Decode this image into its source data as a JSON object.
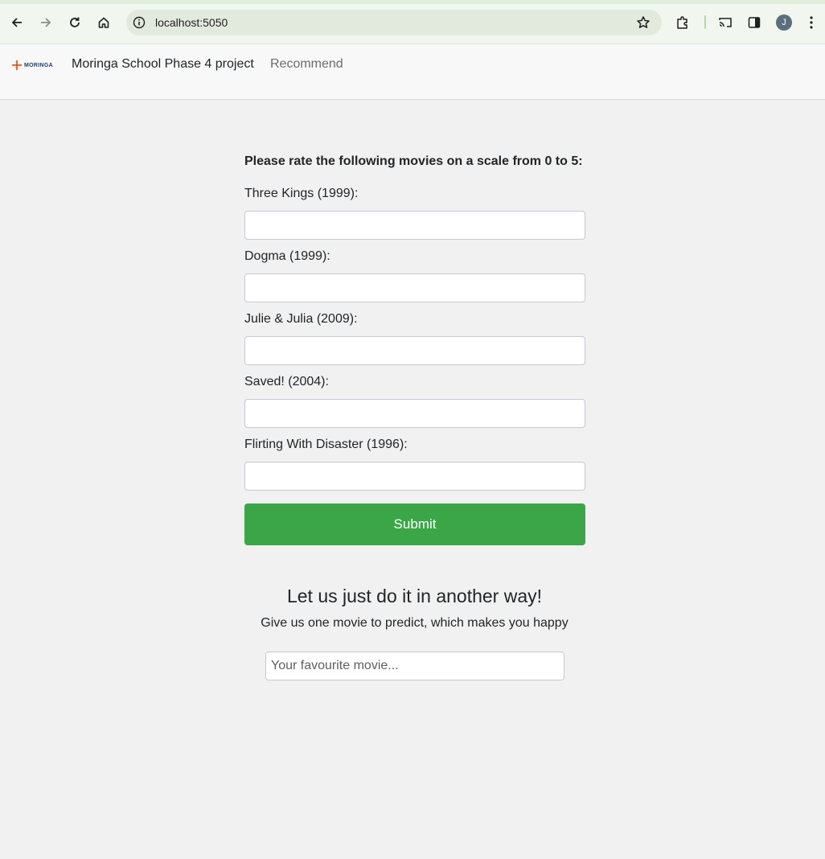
{
  "browser": {
    "url": "localhost:5050",
    "profile_initial": "J",
    "icons": [
      "back-icon",
      "forward-icon",
      "reload-icon",
      "home-icon",
      "info-icon",
      "star-icon",
      "extensions-icon",
      "cast-icon",
      "side-panel-icon",
      "menu-icon"
    ]
  },
  "navbar": {
    "logo_text": "MORINGA",
    "brand": "Moringa School Phase 4 project",
    "link_recommend": "Recommend"
  },
  "rating_form": {
    "intro": "Please rate the following movies on a scale from 0 to 5:",
    "movies": [
      {
        "label": "Three Kings (1999):",
        "value": ""
      },
      {
        "label": "Dogma (1999):",
        "value": ""
      },
      {
        "label": "Julie & Julia (2009):",
        "value": ""
      },
      {
        "label": "Saved! (2004):",
        "value": ""
      },
      {
        "label": "Flirting With Disaster (1996):",
        "value": ""
      }
    ],
    "submit_label": "Submit",
    "submit_color": "#3aa648"
  },
  "alternative": {
    "title": "Let us just do it in another way!",
    "subtitle": "Give us one movie to predict, which makes you happy",
    "input_placeholder": "Your favourite movie..."
  }
}
